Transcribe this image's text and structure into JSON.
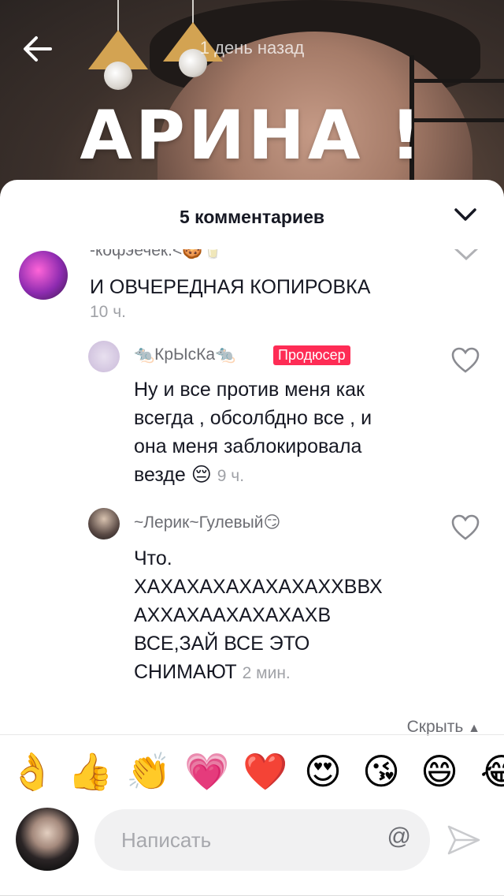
{
  "video": {
    "time_ago": "1 день назад",
    "overlay_title": "АРИНА !"
  },
  "comments_panel": {
    "title": "5 комментариев",
    "comments": [
      {
        "username": "-кофэечек.<🍪🥛",
        "text": "И ОВЧЕРЕДНАЯ КОПИРОВКА",
        "time": "10 ч."
      },
      {
        "username": "🐀КрЫсКа🐀",
        "badge": "Продюсер",
        "text_lines": [
          "Ну и все против меня как",
          "всегда , обсолбдно все , и",
          "она меня заблокировала",
          "везде 😔"
        ],
        "time": "9 ч."
      },
      {
        "username": "~Лерик~Гулевый😏",
        "text_lines": [
          "Что.",
          "ХАХАХАХАХАХАХАХХВВХ",
          "АХХАХААХАХАХАХВ",
          "ВСЕ,ЗАЙ ВСЕ ЭТО",
          "СНИМАЮТ"
        ],
        "time": "2 мин."
      }
    ],
    "hide_label": "Скрыть"
  },
  "emoji_bar": [
    "👌",
    "👍",
    "👏",
    "💗",
    "❤️",
    "😍",
    "😘",
    "😄",
    "😂"
  ],
  "input": {
    "placeholder": "Написать",
    "mention_symbol": "@"
  },
  "colors": {
    "badge": "#fe2c55",
    "text_primary": "#161823",
    "text_secondary": "#a0a2a7"
  }
}
